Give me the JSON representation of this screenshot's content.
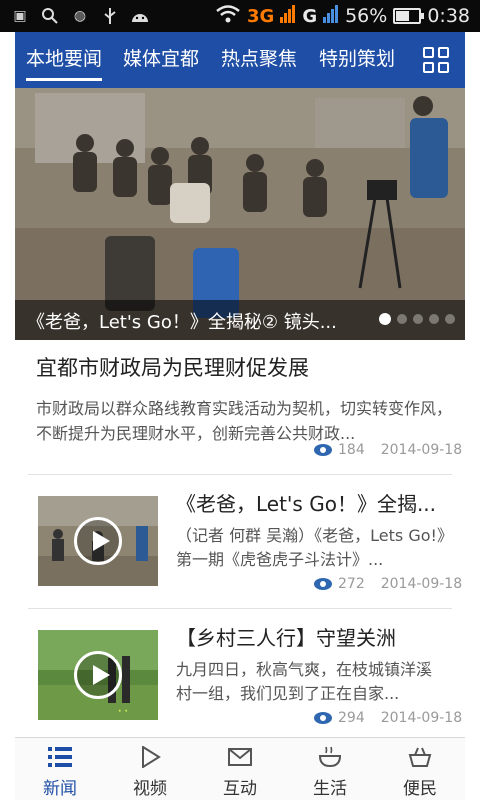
{
  "status_bar": {
    "network": "3G",
    "network2": "G",
    "battery_percent": "56%",
    "battery_level": 0.56,
    "time": "0:38",
    "icons": [
      "notification-icon",
      "search-icon",
      "app-icon",
      "usb-icon",
      "android-icon",
      "wifi-icon",
      "signal-icon",
      "battery-icon"
    ]
  },
  "tabs": [
    {
      "label": "本地要闻",
      "active": true
    },
    {
      "label": "媒体宜都",
      "active": false
    },
    {
      "label": "热点聚焦",
      "active": false
    },
    {
      "label": "特别策划",
      "active": false
    }
  ],
  "tab_grid_icon": "grid-icon",
  "hero": {
    "caption": "《老爸，Let's Go！》全揭秘② 镜头...",
    "slide_count": 5,
    "active_slide": 1
  },
  "articles": [
    {
      "title": "宜都市财政局为民理财促发展",
      "summary": "市财政局以群众路线教育实践活动为契机，切实转变作风，不断提升为民理财水平，创新完善公共财政...",
      "views": "184",
      "date": "2014-09-18"
    },
    {
      "title": "《老爸，Let's Go！》全揭...",
      "summary": "（记者 何群 吴瀚）《老爸，Lets Go!》第一期《虎爸虎子斗法计》...",
      "views": "272",
      "date": "2014-09-18",
      "has_video": true
    },
    {
      "title": "【乡村三人行】守望关洲",
      "summary": "九月四日，秋高气爽，在枝城镇洋溪村一组，我们见到了正在自家...",
      "views": "294",
      "date": "2014-09-18",
      "has_video": true
    }
  ],
  "bottom_nav": [
    {
      "label": "新闻",
      "icon": "list-icon",
      "active": true
    },
    {
      "label": "视频",
      "icon": "play-icon",
      "active": false
    },
    {
      "label": "互动",
      "icon": "mail-icon",
      "active": false
    },
    {
      "label": "生活",
      "icon": "bowl-icon",
      "active": false
    },
    {
      "label": "便民",
      "icon": "basket-icon",
      "active": false
    }
  ],
  "colors": {
    "brand": "#1f4ea6",
    "status_bar": "#0a0a0a",
    "network_accent": "#ff7a00"
  }
}
